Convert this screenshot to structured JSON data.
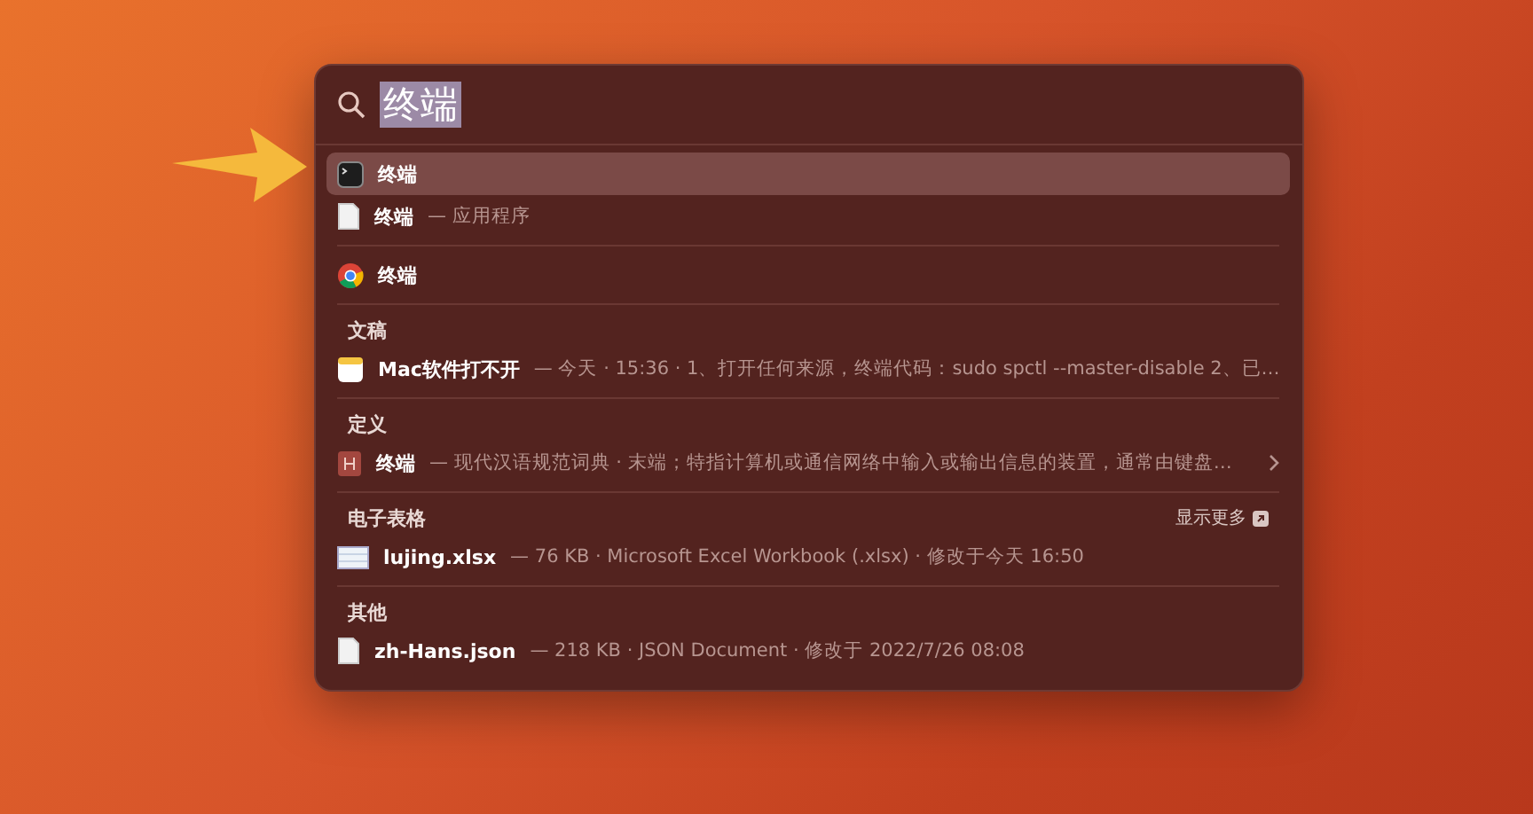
{
  "search": {
    "value": "终端"
  },
  "sections": [
    {
      "items": [
        {
          "kind": "terminal",
          "title": "终端",
          "selected": true
        },
        {
          "kind": "document",
          "title": "终端",
          "detail": "— 应用程序",
          "selected": false
        }
      ]
    },
    {
      "items": [
        {
          "kind": "chrome",
          "title": "终端",
          "selected": false
        }
      ]
    },
    {
      "heading": "文稿",
      "items": [
        {
          "kind": "note",
          "title": "Mac软件打不开",
          "detail": "— 今天 · 15:36 · 1、打开任何来源，终端代码：sudo spctl --master-disable 2、已…",
          "selected": false
        }
      ]
    },
    {
      "heading": "定义",
      "items": [
        {
          "kind": "dictionary",
          "title": "终端",
          "detail": "— 现代汉语规范词典 · 末端；特指计算机或通信网络中输入或输出信息的装置，通常由键盘…",
          "selected": false,
          "chevron": true
        }
      ]
    },
    {
      "heading": "电子表格",
      "action": "显示更多",
      "items": [
        {
          "kind": "spreadsheet",
          "title": "lujing.xlsx",
          "detail": "— 76 KB · Microsoft Excel Workbook (.xlsx) · 修改于今天 16:50",
          "selected": false
        }
      ]
    },
    {
      "heading": "其他",
      "items": [
        {
          "kind": "document",
          "title": "zh-Hans.json",
          "detail": "— 218 KB · JSON Document · 修改于 2022/7/26 08:08",
          "selected": false
        }
      ]
    }
  ]
}
